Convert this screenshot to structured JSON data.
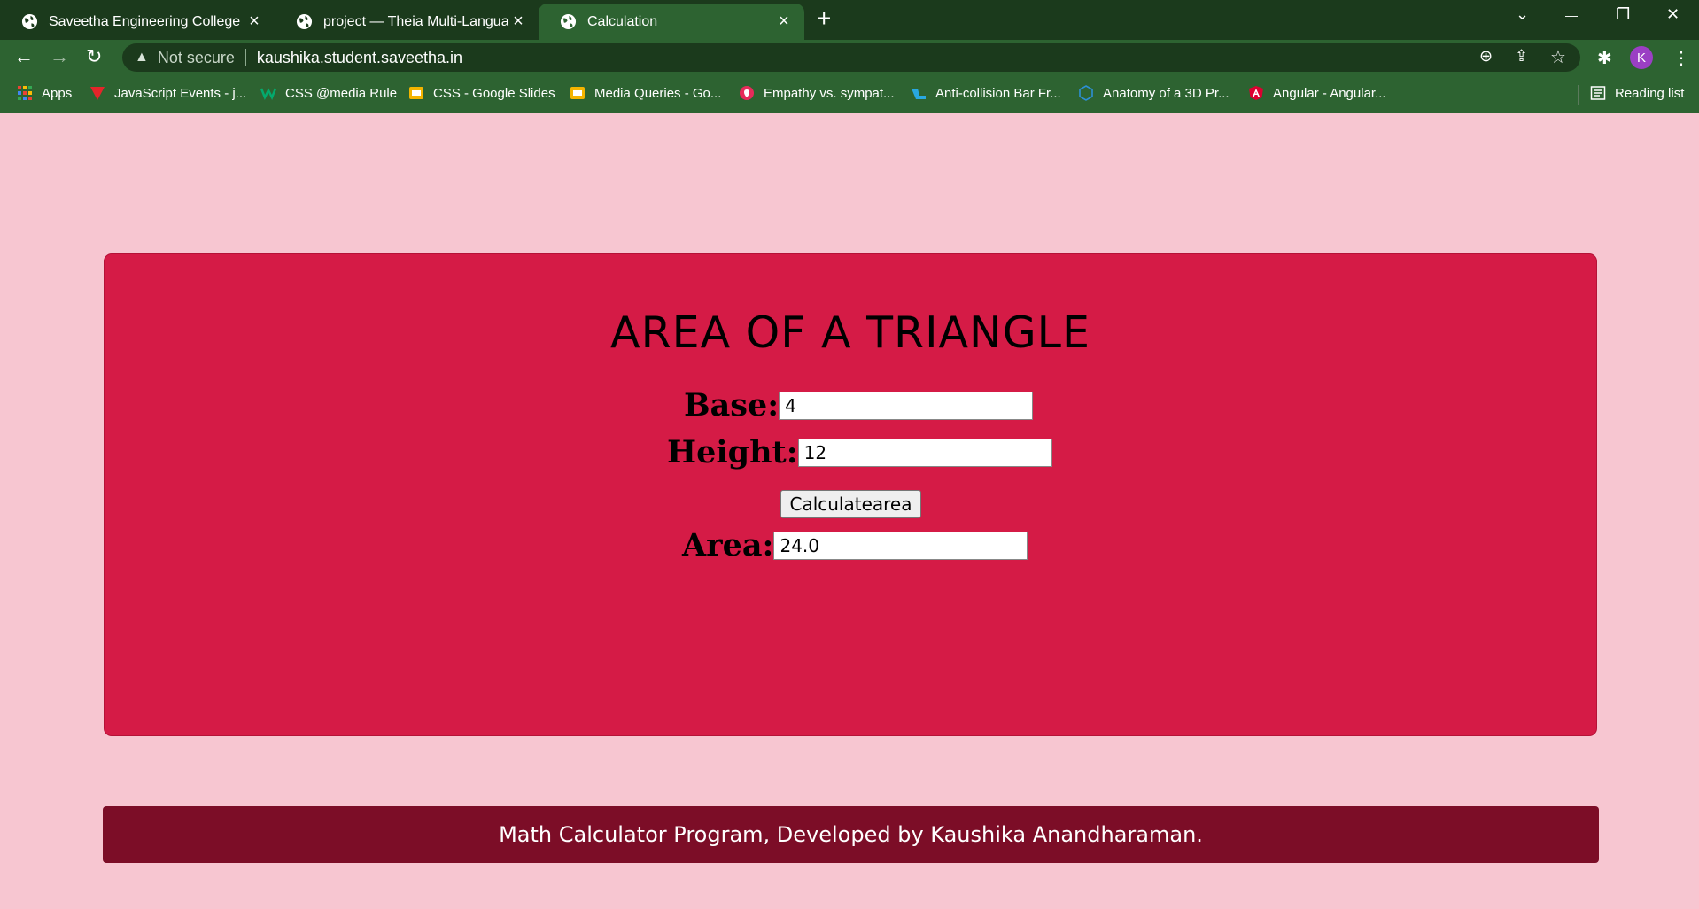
{
  "browser": {
    "tabs": [
      {
        "label": "Saveetha Engineering College",
        "icon": "globe-icon"
      },
      {
        "label": "project — Theia Multi-Language",
        "icon": "globe-icon"
      },
      {
        "label": "Calculation",
        "icon": "globe-icon",
        "active": true
      }
    ],
    "new_tab": "+",
    "window_controls": {
      "tab_search": "⌄",
      "minimize": "—",
      "restore": "❐",
      "close": "✕"
    },
    "nav": {
      "back": "←",
      "forward": "→",
      "reload": "↻"
    },
    "address": {
      "security_icon": "▲",
      "security_text": "Not secure",
      "url": "kaushika.student.saveetha.in"
    },
    "toolbar_icons": {
      "zoom": "⊕",
      "share": "⇪",
      "star": "☆",
      "extensions": "✱",
      "menu": "⋮"
    },
    "profile_initial": "K",
    "bookmarks": [
      {
        "label": "Apps",
        "icon": "apps-grid-icon"
      },
      {
        "label": "JavaScript Events - j...",
        "icon": "javascript-events-icon"
      },
      {
        "label": "CSS @media Rule",
        "icon": "w3schools-icon"
      },
      {
        "label": "CSS - Google Slides",
        "icon": "google-slides-icon"
      },
      {
        "label": "Media Queries - Go...",
        "icon": "google-slides-icon"
      },
      {
        "label": "Empathy vs. sympat...",
        "icon": "empathy-icon"
      },
      {
        "label": "Anti-collision Bar Fr...",
        "icon": "anti-collision-icon"
      },
      {
        "label": "Anatomy of a 3D Pr...",
        "icon": "anatomy-3d-icon"
      },
      {
        "label": "Angular - Angular...",
        "icon": "angular-icon"
      }
    ],
    "reading_list": "Reading list"
  },
  "page": {
    "title": "AREA OF A TRIANGLE",
    "base_label": "Base:",
    "base_value": "4",
    "height_label": "Height:",
    "height_value": "12",
    "button_label": "Calculatearea",
    "area_label": "Area:",
    "area_value": "24.0",
    "footer": "Math Calculator Program, Developed by Kaushika Anandharaman."
  },
  "colors": {
    "page_bg": "#f7c6d1",
    "card_bg": "#d51b46",
    "footer_bg": "#7c0d27",
    "chrome_dark": "#1b3a1c",
    "chrome_light": "#2d6331"
  }
}
